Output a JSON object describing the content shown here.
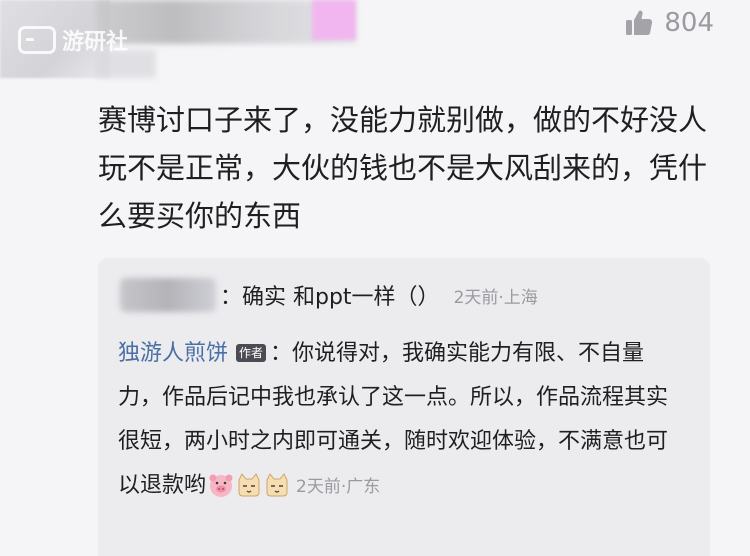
{
  "header": {
    "watermark": "游研社",
    "like_count": "804"
  },
  "comment": {
    "text": "赛博讨口子来了，没能力就别做，做的不好没人玩不是正常，大伙的钱也不是大风刮来的，凭什么要买你的东西"
  },
  "replies": [
    {
      "text": "：确实 和ppt一样（）",
      "meta": "2天前·上海"
    },
    {
      "author": "独游人煎饼",
      "author_tag": "作者",
      "text": "：你说得对，我确实能力有限、不自量力，作品后记中我也承认了这一点。所以，作品流程其实很短，两小时之内即可通关，随时欢迎体验，不满意也可以退款哟",
      "meta": "2天前·广东"
    }
  ],
  "colors": {
    "author_link": "#4a6fa5",
    "meta_text": "#9a9aa0",
    "reply_bg": "#ececef"
  }
}
